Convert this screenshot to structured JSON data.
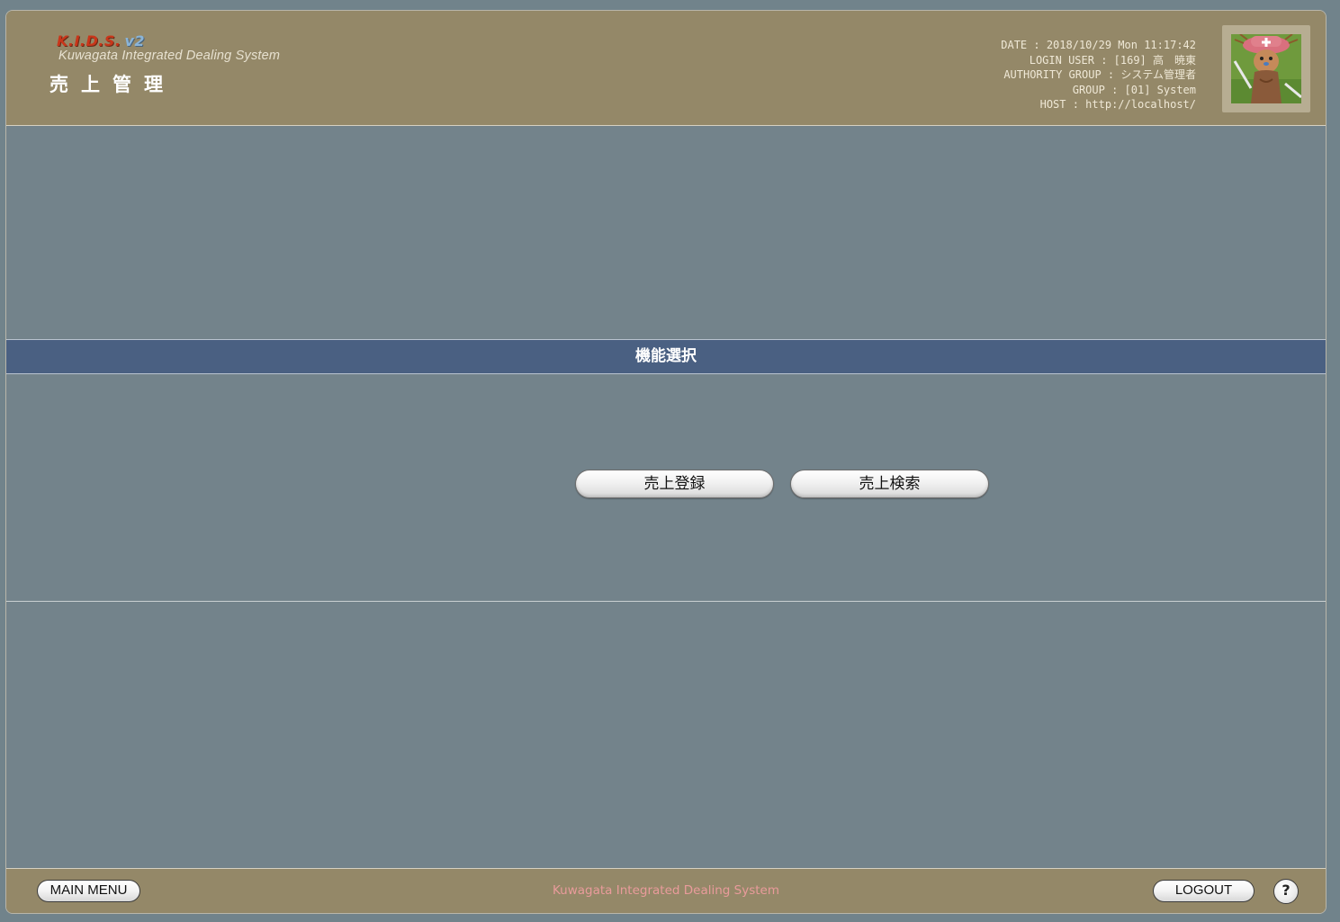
{
  "header": {
    "logo_main": "K.I.D.S.",
    "logo_version": "v2",
    "logo_subtitle": "Kuwagata Integrated Dealing System",
    "page_title": "売上管理",
    "info": {
      "date": "DATE : 2018/10/29 Mon 11:17:42",
      "login_user": "LOGIN USER : [169] 高　暁東",
      "authority_group": "AUTHORITY GROUP : システム管理者",
      "group": "GROUP : [01] System",
      "host": "HOST : http://localhost/"
    }
  },
  "section": {
    "title": "機能選択"
  },
  "actions": {
    "register_label": "売上登録",
    "search_label": "売上検索"
  },
  "footer": {
    "main_menu_label": "MAIN MENU",
    "system_name": "Kuwagata Integrated Dealing System",
    "logout_label": "LOGOUT",
    "help_label": "?"
  },
  "colors": {
    "header_bg": "#948868",
    "body_bg": "#73838b",
    "section_bar_bg": "#4a6082",
    "footer_text": "#e99b9b"
  },
  "icons": {
    "avatar": "user-avatar-image",
    "help": "question-mark-icon"
  }
}
